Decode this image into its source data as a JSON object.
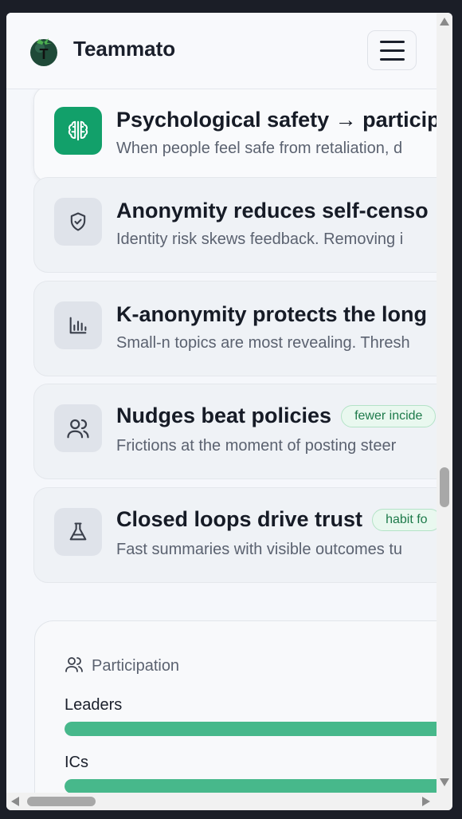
{
  "header": {
    "brand": "Teammato",
    "logo_icon": "tomato-logo-icon",
    "menu_icon": "hamburger-menu-icon"
  },
  "cards": [
    {
      "title": "Psychological safety → particip",
      "desc": "When people feel safe from retaliation, d",
      "icon": "brain-icon",
      "tag": ""
    },
    {
      "title": "Anonymity reduces self-censo",
      "desc": "Identity risk skews feedback. Removing i",
      "icon": "shield-check-icon",
      "tag": ""
    },
    {
      "title": "K-anonymity protects the long",
      "desc": "Small-n topics are most revealing. Thresh",
      "icon": "bar-chart-icon",
      "tag": ""
    },
    {
      "title": "Nudges beat policies",
      "desc": "Frictions at the moment of posting steer",
      "icon": "users-icon",
      "tag": "fewer incide"
    },
    {
      "title": "Closed loops drive trust",
      "desc": "Fast summaries with visible outcomes tu",
      "icon": "flask-icon",
      "tag": "habit fo"
    }
  ],
  "participation": {
    "title": "Participation",
    "icon": "users-icon",
    "bars": [
      {
        "label": "Leaders",
        "value": 1.0
      },
      {
        "label": "ICs",
        "value": 1.0
      }
    ]
  },
  "colors": {
    "accent": "#12a06a",
    "bar": "#47b88b",
    "tag_bg": "#e9f8ef",
    "tag_text": "#1d7a4a"
  }
}
